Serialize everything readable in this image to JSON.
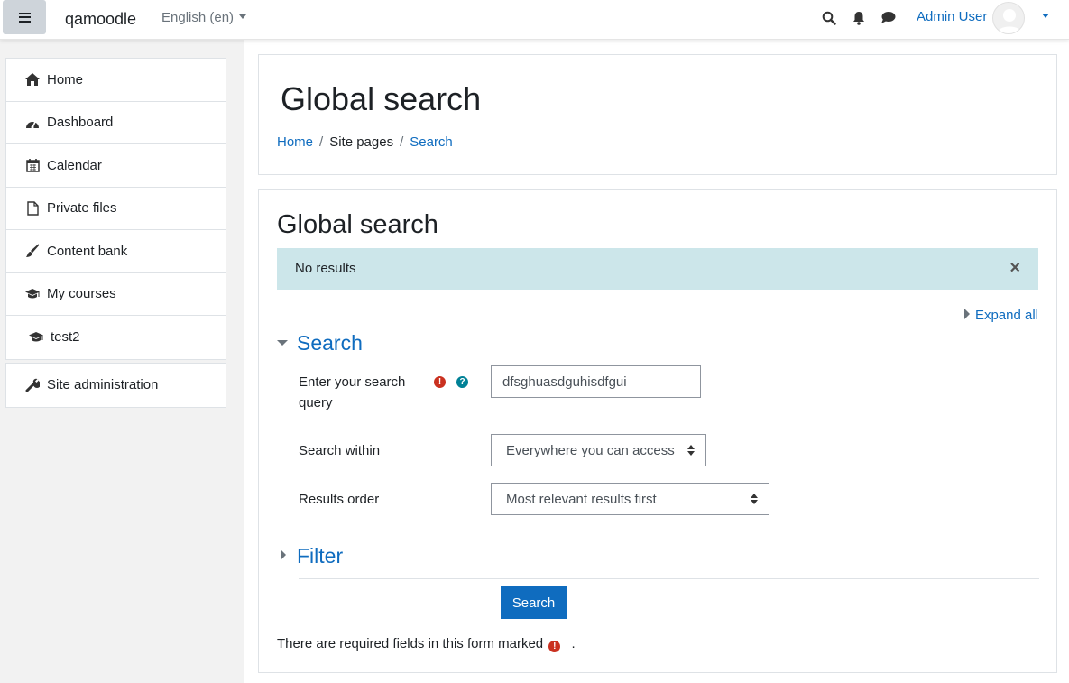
{
  "navbar": {
    "brand": "qamoodle",
    "language": "English (en)",
    "user_name": "Admin User",
    "icons": [
      "menu-icon",
      "search-icon",
      "bell-icon",
      "chat-icon"
    ]
  },
  "sidebar": {
    "items": [
      {
        "label": "Home",
        "icon": "home-icon"
      },
      {
        "label": "Dashboard",
        "icon": "dashboard-icon"
      },
      {
        "label": "Calendar",
        "icon": "calendar-icon"
      },
      {
        "label": "Private files",
        "icon": "file-icon"
      },
      {
        "label": "Content bank",
        "icon": "brush-icon"
      },
      {
        "label": "My courses",
        "icon": "graduation-cap-icon"
      },
      {
        "label": "test2",
        "icon": "graduation-cap-icon"
      }
    ],
    "admin": {
      "label": "Site administration",
      "icon": "wrench-icon"
    }
  },
  "header": {
    "title": "Global search",
    "breadcrumb": [
      "Home",
      "Site pages",
      "Search"
    ]
  },
  "main": {
    "heading": "Global search",
    "alert": "No results",
    "expand_all": "Expand all",
    "search_section": "Search",
    "query_label": "Enter your search query",
    "query_value": "dfsghuasdguhisdfgui",
    "within_label": "Search within",
    "within_value": "Everywhere you can access",
    "order_label": "Results order",
    "order_value": "Most relevant results first",
    "filter_section": "Filter",
    "search_button": "Search",
    "required_note": "There are required fields in this form marked",
    "required_note_end": "."
  },
  "colors": {
    "link": "#0f6cbf",
    "alert_bg": "#cce6ea",
    "required": "#ca3120",
    "help": "#008196"
  }
}
